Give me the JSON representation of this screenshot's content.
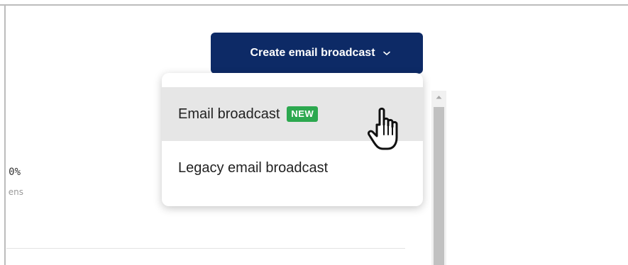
{
  "stat": {
    "value": "0%",
    "label": "ens"
  },
  "create_button": {
    "label": "Create email broadcast",
    "icon": "chevron-down-icon",
    "color": "#0d2a66"
  },
  "dropdown": {
    "items": [
      {
        "label": "Email broadcast",
        "badge": "NEW",
        "badge_color": "#2ca84f",
        "highlighted": true
      },
      {
        "label": "Legacy email broadcast"
      }
    ]
  },
  "cursor": {
    "icon": "hand-pointer-icon"
  },
  "scrollbar": {
    "icon": "scroll-up-arrow-icon"
  }
}
